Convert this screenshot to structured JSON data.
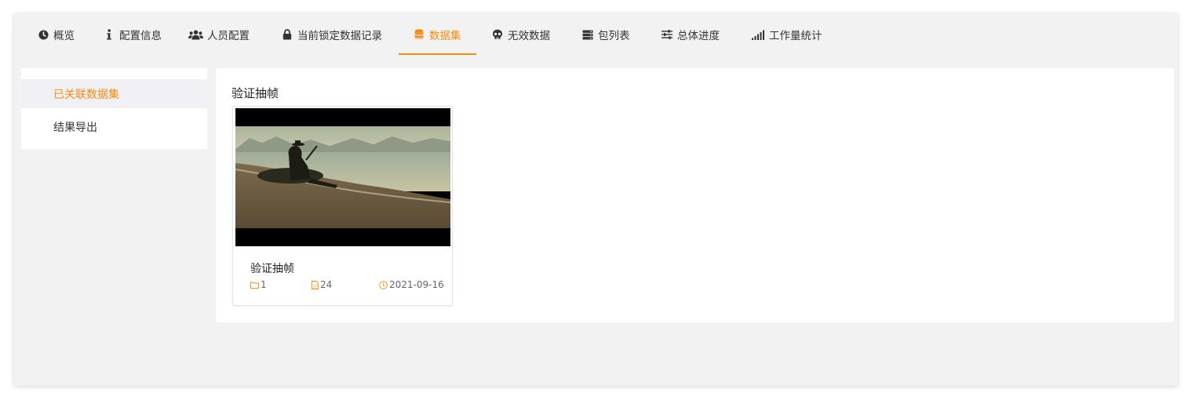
{
  "tabs": [
    {
      "label": "概览",
      "icon": "clock-icon",
      "active": false
    },
    {
      "label": "配置信息",
      "icon": "info-icon",
      "active": false
    },
    {
      "label": "人员配置",
      "icon": "users-icon",
      "active": false
    },
    {
      "label": "当前锁定数据记录",
      "icon": "lock-icon",
      "active": false
    },
    {
      "label": "数据集",
      "icon": "database-icon",
      "active": true
    },
    {
      "label": "无效数据",
      "icon": "skull-icon",
      "active": false
    },
    {
      "label": "包列表",
      "icon": "server-icon",
      "active": false
    },
    {
      "label": "总体进度",
      "icon": "sliders-icon",
      "active": false
    },
    {
      "label": "工作量统计",
      "icon": "signal-bars-icon",
      "active": false
    }
  ],
  "sidebar": {
    "items": [
      {
        "label": "已关联数据集",
        "active": true
      },
      {
        "label": "结果导出",
        "active": false
      }
    ]
  },
  "content": {
    "title": "验证抽帧",
    "cards": [
      {
        "title": "验证抽帧",
        "folders": "1",
        "files": "24",
        "date": "2021-09-16",
        "thumbnail": "beach-sunset-rider-thumbnail"
      }
    ]
  },
  "colors": {
    "accent": "#f08c14",
    "window_bg": "#f2f2f2",
    "active_item_bg": "#f0f0f5"
  }
}
